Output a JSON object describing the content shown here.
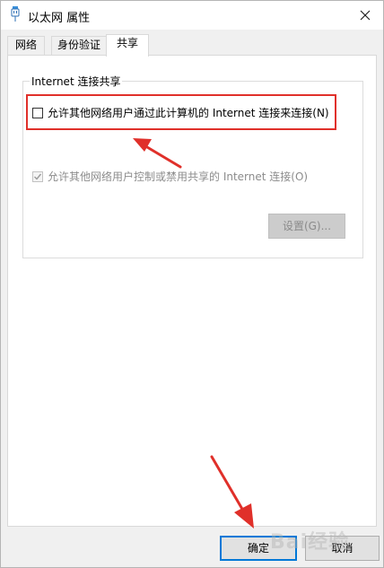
{
  "window": {
    "title": "以太网 属性"
  },
  "tabs": [
    {
      "label": "网络"
    },
    {
      "label": "身份验证"
    },
    {
      "label": "共享"
    }
  ],
  "group": {
    "legend": "Internet 连接共享",
    "allow_share_label": "允许其他网络用户通过此计算机的 Internet 连接来连接(N)",
    "allow_share_checked": false,
    "allow_control_label": "允许其他网络用户控制或禁用共享的 Internet 连接(O)",
    "allow_control_checked": true,
    "settings_label": "设置(G)..."
  },
  "buttons": {
    "ok_label": "确定",
    "cancel_label": "取消"
  },
  "annotations": {
    "highlight_color": "#e0302a",
    "watermark_text": "Bai经验"
  },
  "colors": {
    "accent": "#0078d7",
    "annotation_red": "#e0302a"
  }
}
